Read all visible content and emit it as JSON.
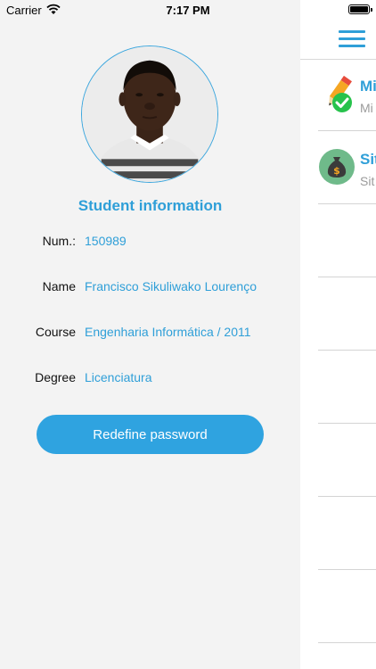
{
  "status_bar": {
    "carrier": "Carrier",
    "time": "7:17 PM"
  },
  "drawer": {
    "section_title": "Student information",
    "fields": [
      {
        "label": "Num.:",
        "value": "150989"
      },
      {
        "label": "Name",
        "value": "Francisco Sikuliwako Lourenço"
      },
      {
        "label": "Course",
        "value": "Engenharia Informática / 2011"
      },
      {
        "label": "Degree",
        "value": "Licenciatura"
      }
    ],
    "redefine_button": "Redefine password"
  },
  "main": {
    "items": [
      {
        "title": "Mi",
        "subtitle": "Mi",
        "icon": "pencil-check-icon"
      },
      {
        "title": "Sit",
        "subtitle": "Sit",
        "icon": "money-bag-icon"
      }
    ]
  },
  "colors": {
    "accent": "#2f9fd8",
    "button": "#2fa3e0",
    "drawer_bg": "#f3f3f3",
    "check_green": "#27c24c"
  }
}
